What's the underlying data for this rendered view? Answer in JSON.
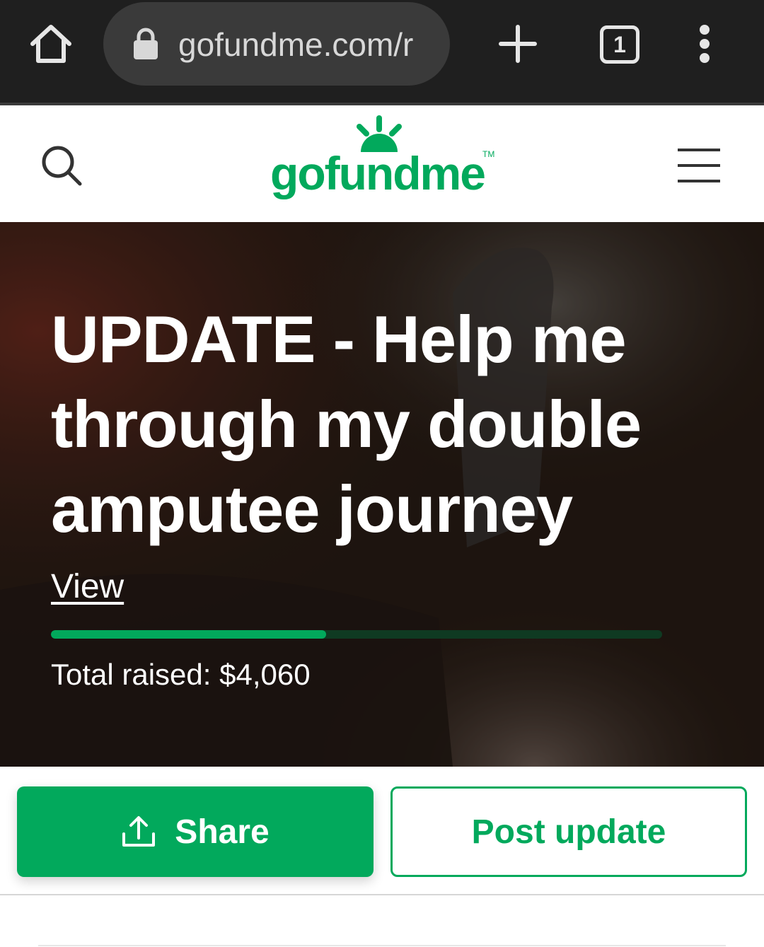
{
  "browser": {
    "url": "gofundme.com/r",
    "tab_count": "1",
    "icons": {
      "home": "home-icon",
      "lock": "lock-icon",
      "new_tab": "plus-icon",
      "menu": "more-vertical-icon"
    },
    "colors": {
      "bar": "#1f1f1f",
      "pill": "#3a3a3a",
      "text": "#d8d8d8"
    }
  },
  "site_header": {
    "logo_text": "gofundme",
    "logo_tm": "TM",
    "icons": {
      "search": "search-icon",
      "menu": "hamburger-menu-icon",
      "logo_sun": "sun-icon"
    },
    "brand_color": "#02a95c"
  },
  "hero": {
    "title": "UPDATE - Help me through my double amputee journey",
    "view_link": "View",
    "progress_fraction": 0.45,
    "total_raised": "Total raised: $4,060"
  },
  "actions": {
    "share_label": "Share",
    "share_icon": "share-upload-icon",
    "post_update_label": "Post update"
  }
}
